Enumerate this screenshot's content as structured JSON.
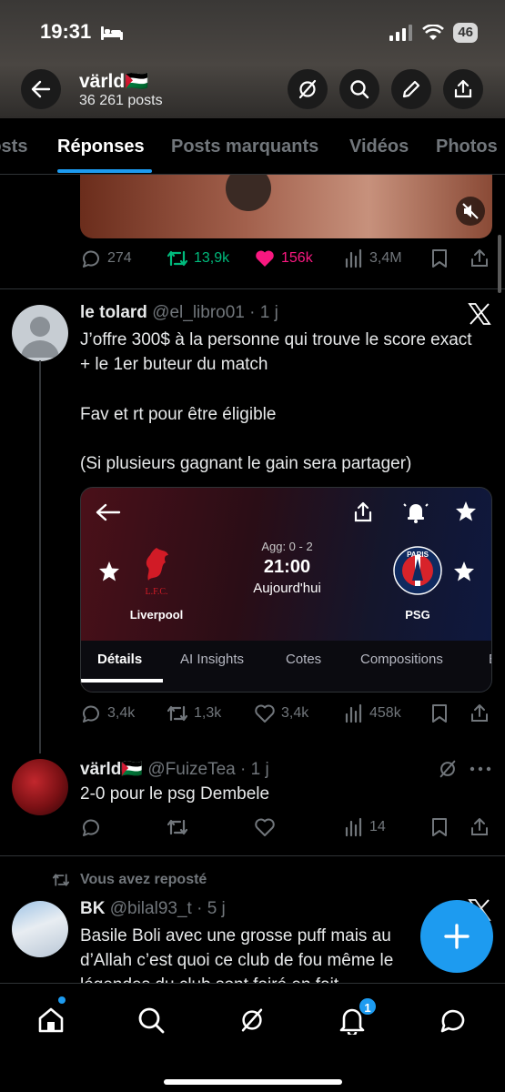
{
  "status_bar": {
    "time": "19:31",
    "battery": "46"
  },
  "header": {
    "profile_name": "värld🇵🇸",
    "post_count": "36 261 posts"
  },
  "tabs": [
    {
      "label": "Posts"
    },
    {
      "label": "Réponses"
    },
    {
      "label": "Posts marquants"
    },
    {
      "label": "Vidéos"
    },
    {
      "label": "Photos"
    }
  ],
  "post1_actions": {
    "replies": "274",
    "reposts": "13,9k",
    "likes": "156k",
    "views": "3,4M"
  },
  "tweet1": {
    "name": "le tolard",
    "handle": "@el_libro01",
    "time": "1 j",
    "lines": [
      "J’offre 300$ à la personne qui trouve le score exact + le 1er buteur du match",
      "Fav et rt pour être éligible",
      "(Si plusieurs gagnant le gain sera partager)"
    ],
    "actions": {
      "replies": "3,4k",
      "reposts": "1,3k",
      "likes": "3,4k",
      "views": "458k"
    }
  },
  "match_card": {
    "home_team": "Liverpool",
    "away_team": "PSG",
    "home_crest_text": "L.F.C.",
    "away_crest_text": "PARIS",
    "aggregate": "Agg: 0 - 2",
    "kickoff": "21:00",
    "day": "Aujourd'hui",
    "tabs": [
      "Détails",
      "AI Insights",
      "Cotes",
      "Compositions",
      "E"
    ]
  },
  "tweet2": {
    "name": "värld🇵🇸",
    "handle": "@FuizeTea",
    "time": "1 j",
    "text": "2-0 pour le psg Dembele",
    "actions": {
      "views": "14"
    }
  },
  "repost_label": "Vous avez reposté",
  "tweet3": {
    "name": "BK",
    "handle": "@bilal93_t",
    "time": "5 j",
    "lines": [
      "Basile Boli avec une grosse puff mais au",
      "d’Allah c’est quoi ce club de fou même le",
      "légendes du club sont foiré en fait"
    ]
  },
  "bottom_nav": {
    "notification_count": "1"
  },
  "colors": {
    "accent": "#1d9bf0",
    "repost_green": "#00ba7c",
    "like_pink": "#f91880",
    "muted": "#71767b"
  }
}
